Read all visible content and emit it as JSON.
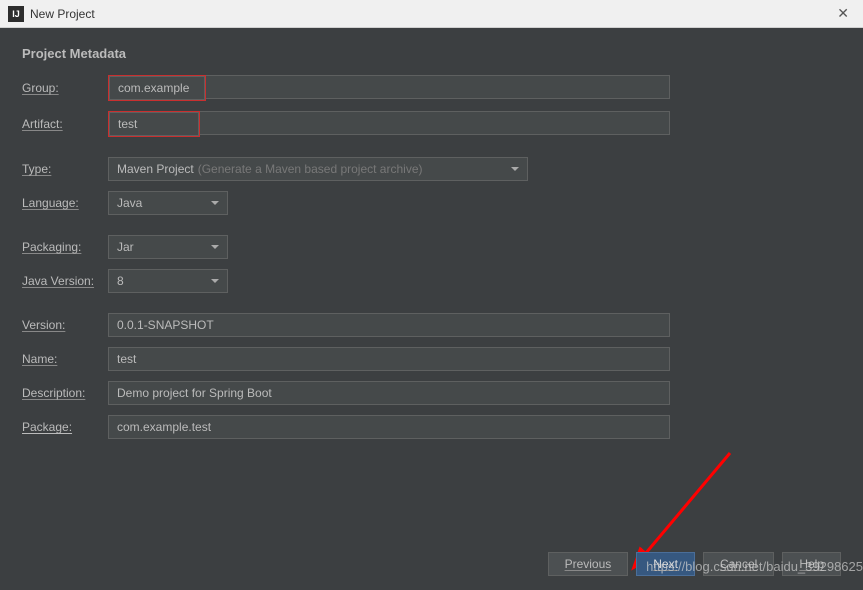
{
  "window": {
    "title": "New Project",
    "icon_text": "IJ"
  },
  "section_title": "Project Metadata",
  "fields": {
    "group": {
      "label": "Group:",
      "value": "com.example"
    },
    "artifact": {
      "label": "Artifact:",
      "value": "test"
    },
    "type": {
      "label": "Type:",
      "value": "Maven Project",
      "hint": "(Generate a Maven based project archive)"
    },
    "language": {
      "label": "Language:",
      "value": "Java"
    },
    "packaging": {
      "label": "Packaging:",
      "value": "Jar"
    },
    "java_version": {
      "label": "Java Version:",
      "value": "8"
    },
    "version": {
      "label": "Version:",
      "value": "0.0.1-SNAPSHOT"
    },
    "name": {
      "label": "Name:",
      "value": "test"
    },
    "description": {
      "label": "Description:",
      "value": "Demo project for Spring Boot"
    },
    "package": {
      "label": "Package:",
      "value": "com.example.test"
    }
  },
  "buttons": {
    "previous": "Previous",
    "next": "Next",
    "cancel": "Cancel",
    "help": "Help"
  },
  "watermark": "https://blog.csdn.net/baidu_39298625"
}
